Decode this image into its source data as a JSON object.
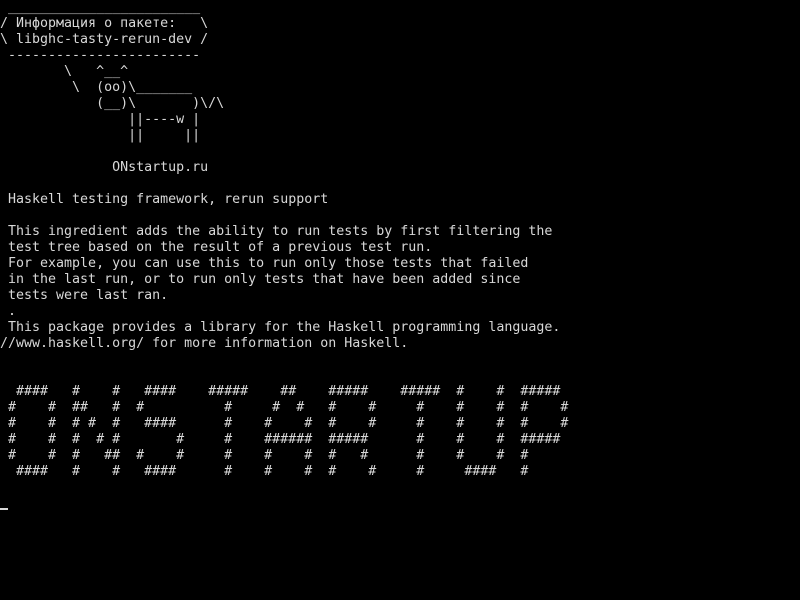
{
  "console": {
    "bubble_top": " ________________________",
    "bubble_title": "/ Информация о пакете:   \\",
    "bubble_package": "\\ libghc-tasty-rerun-dev /",
    "bubble_bottom": " ------------------------",
    "cow_1": "        \\   ^__^",
    "cow_2": "         \\  (oo)\\_______",
    "cow_3": "            (__)\\       )\\/\\",
    "cow_4": "                ||----w |",
    "cow_5": "                ||     ||",
    "site": "              ONstartup.ru",
    "summary": " Haskell testing framework, rerun support",
    "desc_1": " This ingredient adds the ability to run tests by first filtering the",
    "desc_2": " test tree based on the result of a previous test run.",
    "desc_3": " For example, you can use this to run only those tests that failed",
    "desc_4": " in the last run, or to run only tests that have been added since",
    "desc_5": " tests were last ran.",
    "desc_6": " .",
    "desc_7": " This package provides a library for the Haskell programming language.",
    "desc_8": "//www.haskell.org/ for more information on Haskell.",
    "banner_1": "  ####   #    #   ####    #####    ##    #####    #####  #    #  #####",
    "banner_2": " #    #  ##   #  #          #     #  #   #    #     #    #    #  #    #",
    "banner_3": " #    #  # #  #   ####      #    #    #  #    #     #    #    #  #    #",
    "banner_4": " #    #  #  # #       #     #    ######  #####      #    #    #  #####",
    "banner_5": " #    #  #   ##  #    #     #    #    #  #   #      #    #    #  #",
    "banner_6": "  ####   #    #   ####      #    #    #  #    #     #     ####   #"
  },
  "colors": {
    "background": "#000000",
    "text": "#d8d8d8"
  }
}
